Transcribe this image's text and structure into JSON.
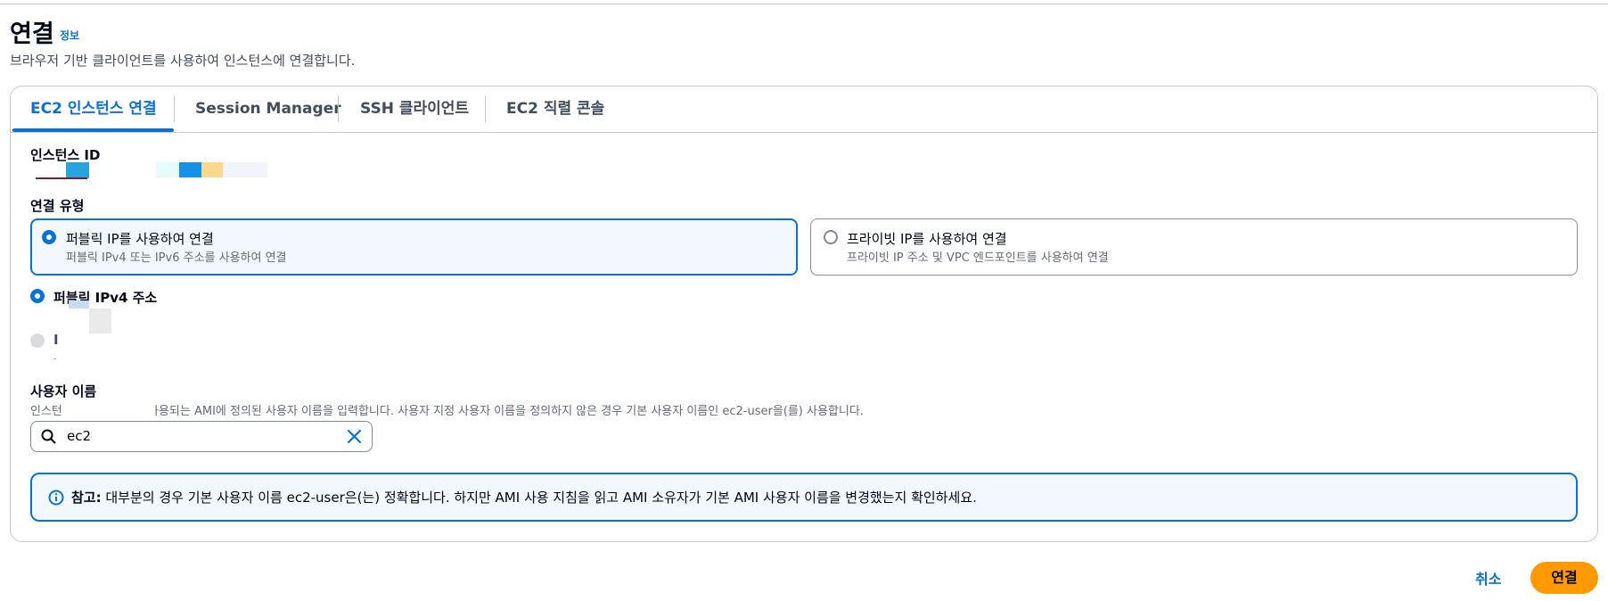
{
  "page": {
    "title": "연결",
    "info_link": "정보",
    "description": "브라우저 기반 클라이언트를 사용하여 인스턴스에 연결합니다."
  },
  "tabs": [
    {
      "label": "EC2 인스턴스 연결",
      "active": true
    },
    {
      "label": "Session Manager",
      "active": false
    },
    {
      "label": "SSH 클라이언트",
      "active": false
    },
    {
      "label": "EC2 직렬 콘솔",
      "active": false
    }
  ],
  "instance": {
    "label": "인스턴스 ID"
  },
  "connection_type": {
    "label": "연결 유형",
    "options": [
      {
        "title": "퍼블릭 IP를 사용하여 연결",
        "subtitle": "퍼블릭 IPv4 또는 IPv6 주소를 사용하여 연결",
        "selected": true
      },
      {
        "title": "프라이빗 IP를 사용하여 연결",
        "subtitle": "프라이빗 IP 주소 및 VPC 엔드포인트를 사용하여 연결",
        "selected": false
      }
    ]
  },
  "address_options": [
    {
      "label": "퍼블릭 IPv4 주소",
      "selected": true
    },
    {
      "label": "I",
      "selected": false,
      "disabled": true
    }
  ],
  "username": {
    "label": "사용자 이름",
    "description": "인스턴스를 시작하는 데 사용되는 AMI에 정의된 사용자 이름을 입력합니다. 사용자 지정 사용자 이름을 정의하지 않은 경우 기본 사용자 이름인 ec2-user을(를) 사용합니다.",
    "value": "ec2-"
  },
  "alert": {
    "title": "참고:",
    "text": " 대부분의 경우 기본 사용자 이름 ec2-user은(는) 정확합니다. 하지만 AMI 사용 지침을 읽고 AMI 소유자가 기본 AMI 사용자 이름을 변경했는지 확인하세요."
  },
  "footer": {
    "cancel_label": "취소",
    "connect_label": "연결"
  },
  "colors": {
    "accent": "#0972d3",
    "primary_button": "#ff9900",
    "selected_bg": "#f2f8fd"
  }
}
